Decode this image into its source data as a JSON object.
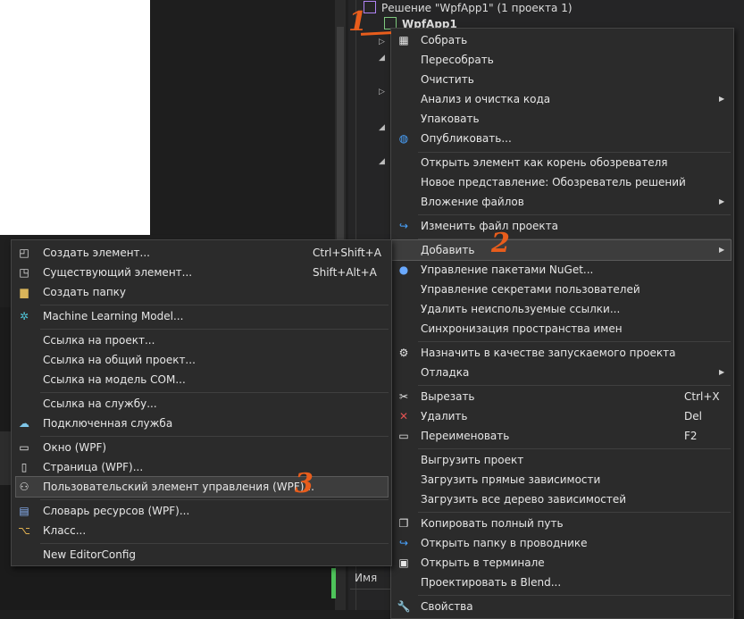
{
  "solution": {
    "header": "Решение \"WpfApp1\"  (1 проекта 1)",
    "project": "WpfApp1"
  },
  "main_menu": {
    "items": [
      {
        "label": "Собрать",
        "icon": "build-icon"
      },
      {
        "label": "Пересобрать"
      },
      {
        "label": "Очистить"
      },
      {
        "label": "Анализ и очистка кода",
        "submenu": true
      },
      {
        "label": "Упаковать"
      },
      {
        "label": "Опубликовать...",
        "icon": "publish-globe-icon"
      },
      {
        "label": "Открыть элемент как корень обозревателя"
      },
      {
        "label": "Новое представление: Обозреватель решений"
      },
      {
        "label": "Вложение файлов",
        "submenu": true
      },
      {
        "label": "Изменить файл проекта",
        "icon": "edit-project-arrow-icon"
      },
      {
        "label": "Добавить",
        "submenu": true,
        "highlighted": true
      },
      {
        "label": "Управление пакетами NuGet...",
        "icon": "nuget-icon"
      },
      {
        "label": "Управление секретами пользователей"
      },
      {
        "label": "Удалить неиспользуемые ссылки..."
      },
      {
        "label": "Синхронизация пространства имен"
      },
      {
        "label": "Назначить в качестве запускаемого проекта",
        "icon": "gear-icon"
      },
      {
        "label": "Отладка",
        "submenu": true
      },
      {
        "label": "Вырезать",
        "icon": "scissors-icon",
        "shortcut": "Ctrl+X"
      },
      {
        "label": "Удалить",
        "icon": "delete-x-icon",
        "shortcut": "Del"
      },
      {
        "label": "Переименовать",
        "icon": "rename-icon",
        "shortcut": "F2"
      },
      {
        "label": "Выгрузить проект"
      },
      {
        "label": "Загрузить прямые зависимости"
      },
      {
        "label": "Загрузить все дерево зависимостей"
      },
      {
        "label": "Копировать полный путь",
        "icon": "copy-icon"
      },
      {
        "label": "Открыть папку в проводнике",
        "icon": "folder-open-arrow-icon"
      },
      {
        "label": "Открыть в терминале",
        "icon": "terminal-icon"
      },
      {
        "label": "Проектировать в Blend..."
      },
      {
        "label": "Свойства",
        "icon": "wrench-icon"
      }
    ]
  },
  "add_submenu": {
    "items": [
      {
        "label": "Создать элемент...",
        "icon": "new-item-icon",
        "shortcut": "Ctrl+Shift+A"
      },
      {
        "label": "Существующий элемент...",
        "icon": "existing-item-icon",
        "shortcut": "Shift+Alt+A"
      },
      {
        "label": "Создать папку",
        "icon": "new-folder-icon"
      },
      {
        "label": "Machine Learning Model...",
        "icon": "ml-model-icon"
      },
      {
        "label": "Ссылка на проект..."
      },
      {
        "label": "Ссылка на общий проект..."
      },
      {
        "label": "Ссылка на модель COM..."
      },
      {
        "label": "Ссылка на службу..."
      },
      {
        "label": "Подключенная служба",
        "icon": "connected-service-icon"
      },
      {
        "label": "Окно (WPF)",
        "icon": "window-icon"
      },
      {
        "label": "Страница (WPF)...",
        "icon": "page-icon"
      },
      {
        "label": "Пользовательский элемент управления (WPF)...",
        "icon": "user-control-icon",
        "highlighted": true
      },
      {
        "label": "Словарь ресурсов (WPF)...",
        "icon": "resource-dictionary-icon"
      },
      {
        "label": "Класс...",
        "icon": "class-icon"
      },
      {
        "label": "New EditorConfig"
      }
    ]
  },
  "panel": {
    "name_column": "Имя"
  },
  "annotations": [
    "1",
    "2",
    "3"
  ],
  "colors": {
    "menu_bg": "#2b2b2b",
    "highlight": "#3d3d3d",
    "annotation": "#e85d1c",
    "accent_green": "#4ec35a"
  }
}
